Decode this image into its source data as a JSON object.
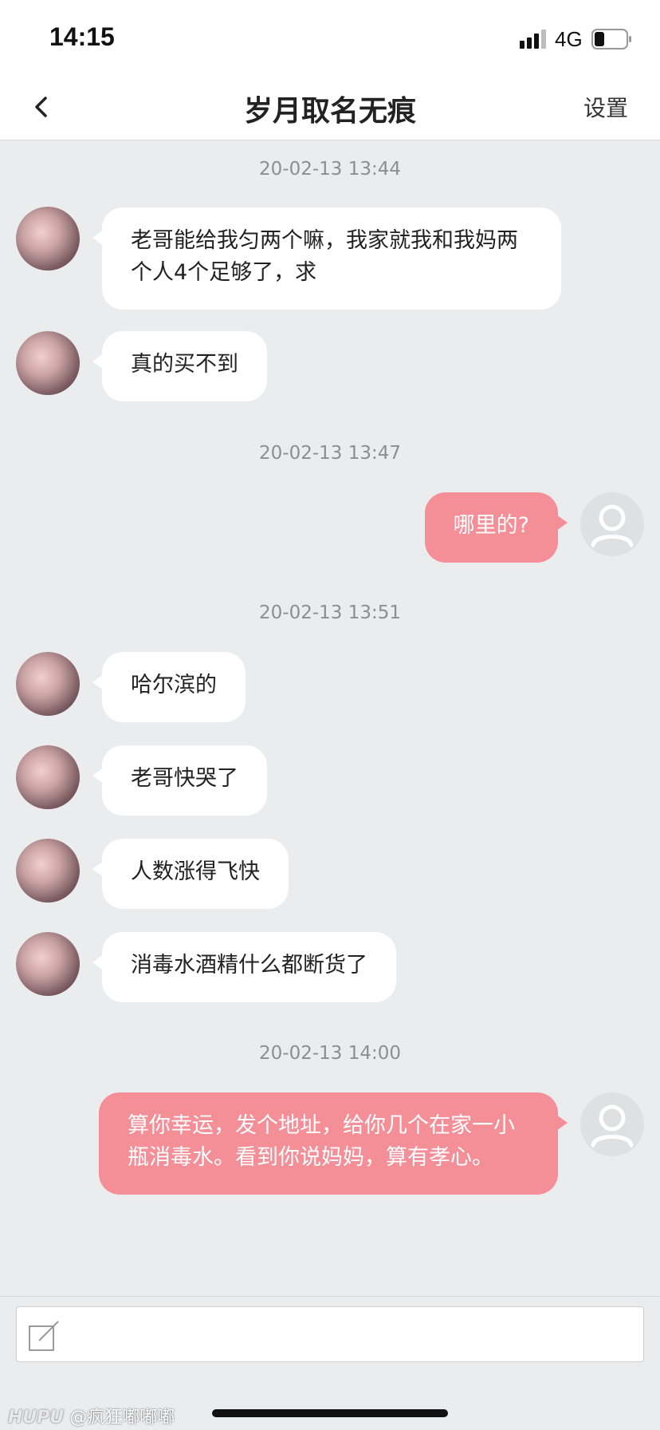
{
  "status_bar": {
    "time": "14:15",
    "network": "4G",
    "icons": [
      "signal-icon",
      "battery-icon"
    ]
  },
  "nav": {
    "back_icon": "chevron-left-icon",
    "title": "岁月取名无痕",
    "settings_label": "设置"
  },
  "chat": {
    "timestamps": [
      "20-02-13 13:44",
      "20-02-13 13:47",
      "20-02-13 13:51",
      "20-02-13 14:00"
    ],
    "messages": [
      {
        "from": "other",
        "text_line1": "老哥能给我匀两个嘛，我家就我和我妈两",
        "text_line2": "个人4个足够了，求"
      },
      {
        "from": "other",
        "text": "真的买不到"
      },
      {
        "from": "self",
        "text": "哪里的?"
      },
      {
        "from": "other",
        "text": "哈尔滨的"
      },
      {
        "from": "other",
        "text": "老哥快哭了"
      },
      {
        "from": "other",
        "text": "人数涨得飞快"
      },
      {
        "from": "other",
        "text": "消毒水酒精什么都断货了"
      },
      {
        "from": "self",
        "text_line1": "算你幸运，发个地址，给你几个在家一小",
        "text_line2": "瓶消毒水。看到你说妈妈，算有孝心。"
      }
    ],
    "colors": {
      "outgoing_bubble": "#f58f97",
      "incoming_bubble": "#ffffff",
      "background": "#ebecee"
    }
  },
  "input": {
    "compose_icon": "compose-icon",
    "placeholder": ""
  },
  "watermark": {
    "brand": "HUPU",
    "handle": "@疯狂嘟嘟嘟"
  }
}
